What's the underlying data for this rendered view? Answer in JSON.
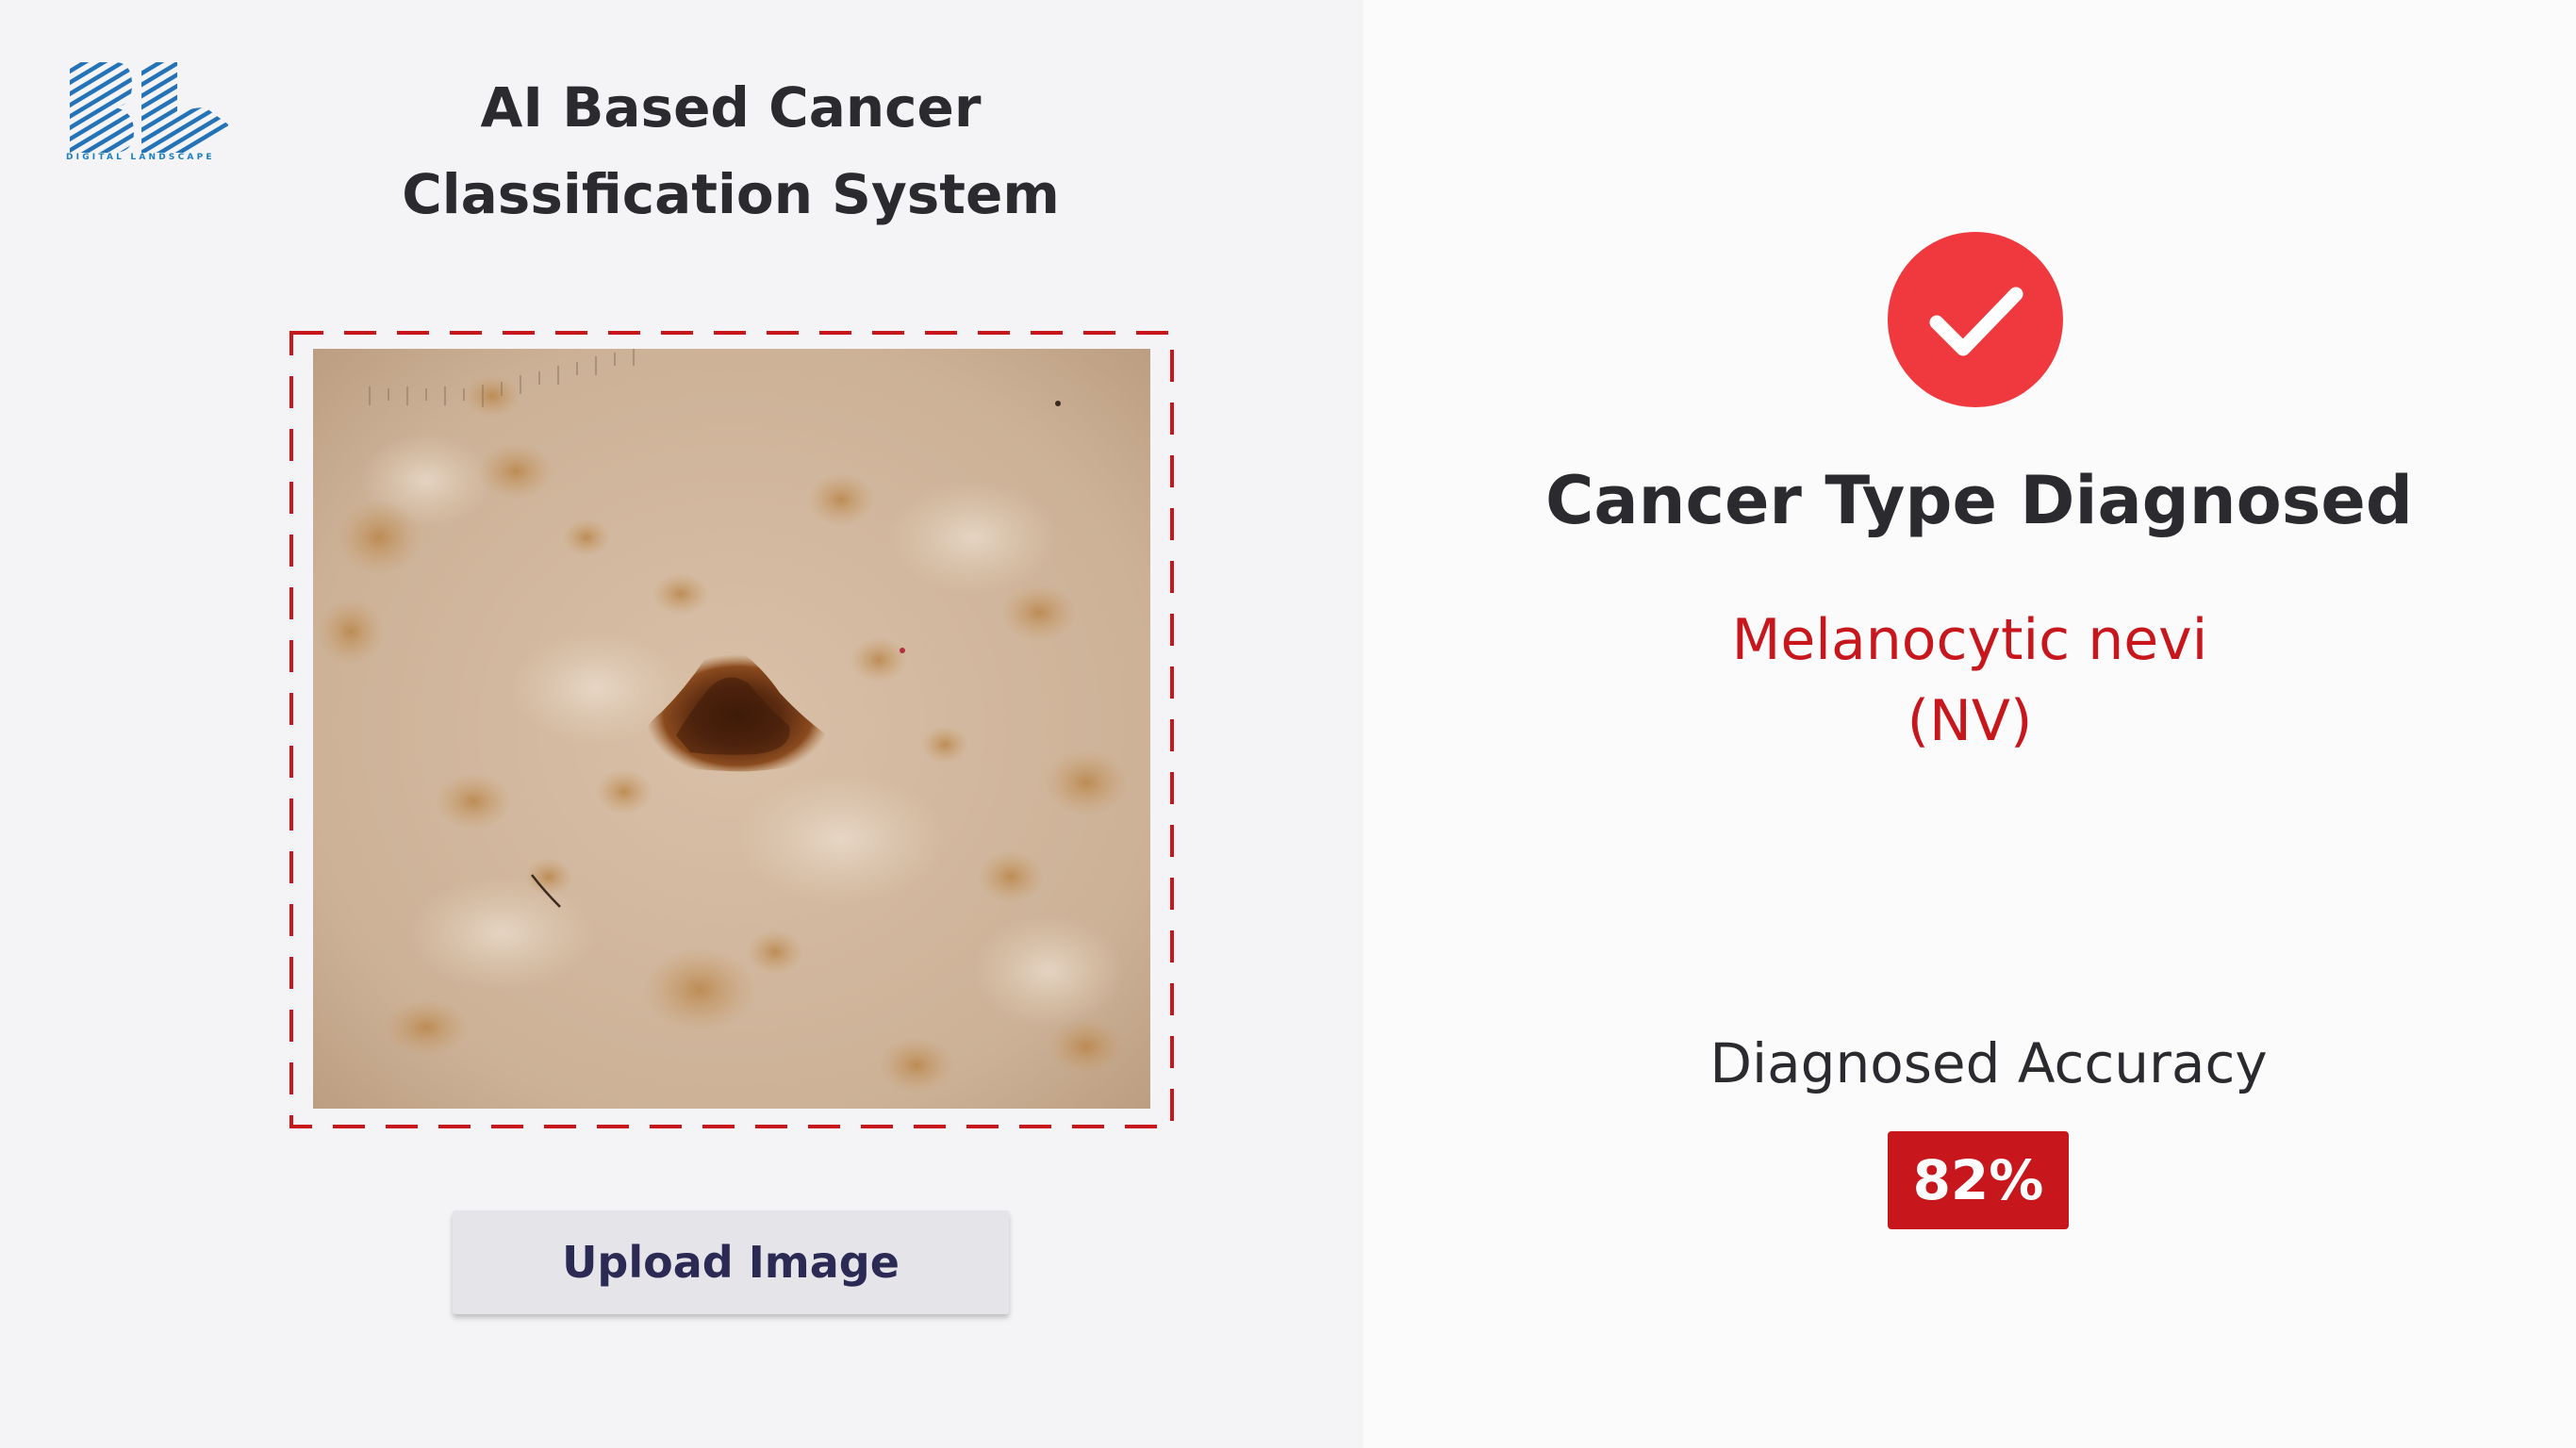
{
  "app": {
    "logo_text": "DIGITAL LANDSCAPE",
    "title_line1": "AI Based Cancer",
    "title_line2": "Classification System"
  },
  "upload": {
    "button_label": "Upload Image",
    "frame_color": "#c8161d"
  },
  "result": {
    "heading": "Cancer Type Diagnosed",
    "diagnosis_line1": "Melanocytic nevi",
    "diagnosis_line2": "(NV)",
    "accuracy_label": "Diagnosed Accuracy",
    "accuracy_value": "82%",
    "accuracy_fraction": 0.82,
    "accent_color": "#c8161d",
    "icon_color": "#f0393f"
  }
}
